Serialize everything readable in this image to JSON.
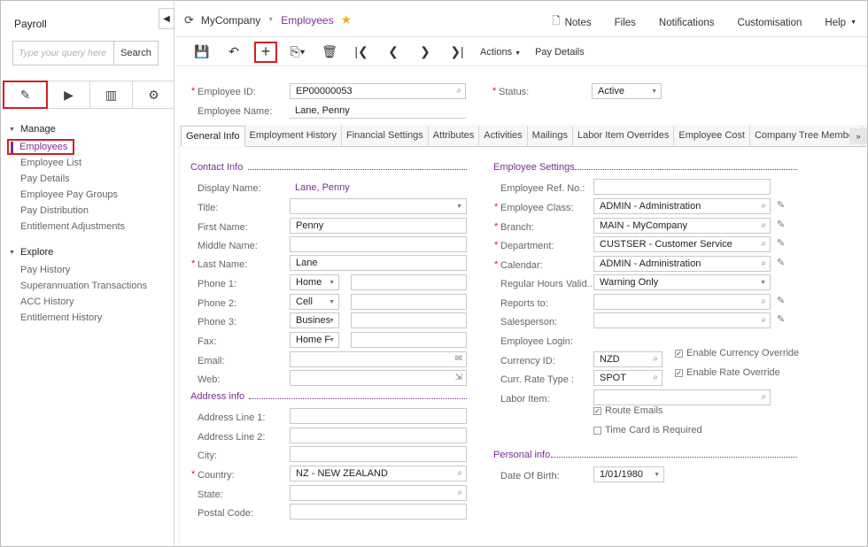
{
  "sidebar": {
    "title": "Payroll",
    "search_placeholder": "Type your query here",
    "search_button": "Search",
    "tabs": [
      {
        "name": "edit-icon",
        "glyph": "✎"
      },
      {
        "name": "play-icon",
        "glyph": "▶"
      },
      {
        "name": "report-icon",
        "glyph": "▥"
      },
      {
        "name": "gear-icon",
        "glyph": "⚙"
      }
    ],
    "manage": {
      "label": "Manage",
      "items": [
        "Employees",
        "Employee List",
        "Pay Details",
        "Employee Pay Groups",
        "Pay Distribution",
        "Entitlement Adjustments"
      ]
    },
    "explore": {
      "label": "Explore",
      "items": [
        "Pay History",
        "Superannuation Transactions",
        "ACC History",
        "Entitlement History"
      ]
    }
  },
  "topbar": {
    "company": "MyCompany",
    "screen": "Employees",
    "links": [
      {
        "label": "Notes",
        "icon": "note-icon"
      },
      {
        "label": "Files"
      },
      {
        "label": "Notifications"
      },
      {
        "label": "Customisation"
      },
      {
        "label": "Help"
      }
    ]
  },
  "toolbar": {
    "actions_label": "Actions",
    "pay_details_label": "Pay Details"
  },
  "header": {
    "employee_id_label": "Employee ID:",
    "employee_id": "EP00000053",
    "employee_name_label": "Employee Name:",
    "employee_name": "Lane, Penny",
    "status_label": "Status:",
    "status": "Active"
  },
  "tabs": [
    "General Info",
    "Employment History",
    "Financial Settings",
    "Attributes",
    "Activities",
    "Mailings",
    "Labor Item Overrides",
    "Employee Cost",
    "Company Tree Member"
  ],
  "contact": {
    "section": "Contact Info",
    "display_name_label": "Display Name:",
    "display_name": "Lane, Penny",
    "title_label": "Title:",
    "title": "",
    "first_name_label": "First Name:",
    "first_name": "Penny",
    "middle_name_label": "Middle Name:",
    "middle_name": "",
    "last_name_label": "Last Name:",
    "last_name": "Lane",
    "phone1_label": "Phone 1:",
    "phone1_type": "Home",
    "phone2_label": "Phone 2:",
    "phone2_type": "Cell",
    "phone3_label": "Phone 3:",
    "phone3_type": "Busines",
    "fax_label": "Fax:",
    "fax_type": "Home F",
    "email_label": "Email:",
    "web_label": "Web:"
  },
  "address": {
    "section": "Address info",
    "line1_label": "Address Line 1:",
    "line2_label": "Address Line 2:",
    "city_label": "City:",
    "country_label": "Country:",
    "country": "NZ - NEW ZEALAND",
    "state_label": "State:",
    "postal_label": "Postal Code:"
  },
  "settings": {
    "section": "Employee Settings",
    "ref_label": "Employee Ref. No.:",
    "class_label": "Employee Class:",
    "class": "ADMIN - Administration",
    "branch_label": "Branch:",
    "branch": "MAIN - MyCompany",
    "dept_label": "Department:",
    "dept": "CUSTSER - Customer Service",
    "calendar_label": "Calendar:",
    "calendar": "ADMIN - Administration",
    "hours_label": "Regular Hours Valid...",
    "hours": "Warning Only",
    "reports_label": "Reports to:",
    "sales_label": "Salesperson:",
    "login_label": "Employee Login:",
    "currency_label": "Currency ID:",
    "currency": "NZD",
    "currency_override": "Enable Currency Override",
    "rate_label": "Curr. Rate Type :",
    "rate": "SPOT",
    "rate_override": "Enable Rate Override",
    "labor_label": "Labor Item:",
    "route_emails": "Route Emails",
    "timecard": "Time Card is Required"
  },
  "personal": {
    "section": "Personal info",
    "dob_label": "Date Of Birth:",
    "dob": "1/01/1980"
  }
}
